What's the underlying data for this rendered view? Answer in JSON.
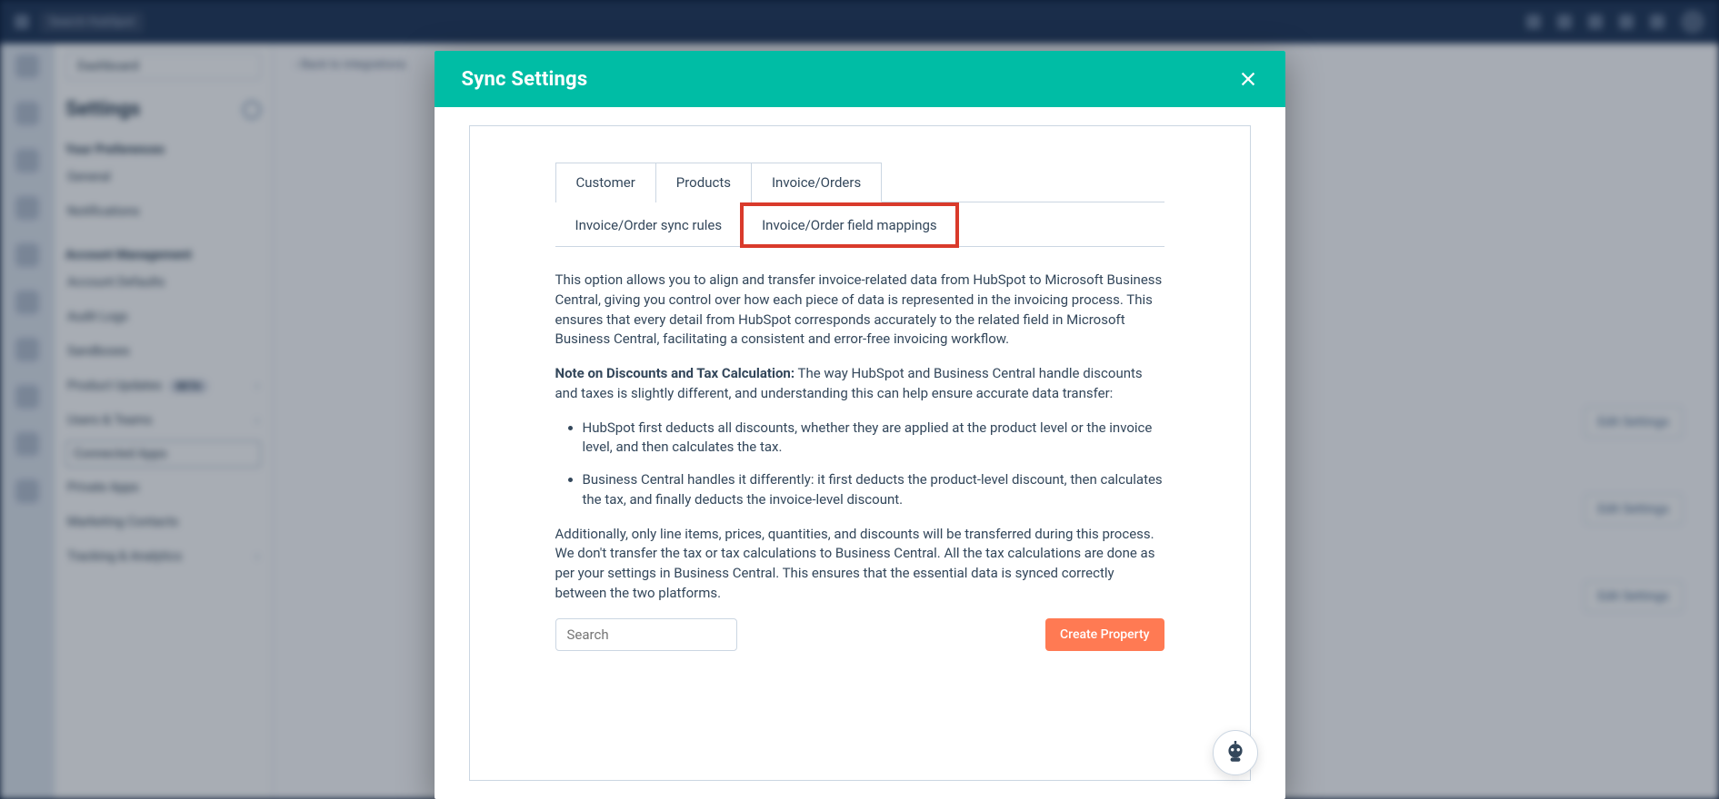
{
  "topbar": {
    "search_placeholder": "Search HubSpot"
  },
  "sidebar": {
    "back_chip": "Dashboard",
    "title": "Settings",
    "section_pref": "Your Preferences",
    "section_acct": "Account Management",
    "items_pref": [
      {
        "label": "General"
      },
      {
        "label": "Notifications"
      }
    ],
    "items_acct": [
      {
        "label": "Account Defaults"
      },
      {
        "label": "Audit Logs"
      },
      {
        "label": "Sandboxes"
      },
      {
        "label": "Product Updates",
        "beta": "BETA",
        "caret": "›"
      },
      {
        "label": "Users & Teams",
        "caret": "›"
      },
      {
        "label": "Connected Apps",
        "active": true
      },
      {
        "label": "Private Apps"
      },
      {
        "label": "Marketing Contacts"
      },
      {
        "label": "Tracking & Analytics",
        "caret": "›"
      }
    ]
  },
  "content": {
    "crumb_back": "‹  Back to integrations",
    "side_button": "Edit Settings"
  },
  "modal": {
    "title": "Sync Settings",
    "tabs_primary": [
      {
        "key": "customer",
        "label": "Customer"
      },
      {
        "key": "products",
        "label": "Products"
      },
      {
        "key": "invoice",
        "label": "Invoice/Orders",
        "selected": true
      }
    ],
    "tabs_secondary": [
      {
        "key": "rules",
        "label": "Invoice/Order sync rules"
      },
      {
        "key": "mappings",
        "label": "Invoice/Order field mappings",
        "highlight": true
      }
    ],
    "desc_p1": "This option allows you to align and transfer invoice-related data from HubSpot to Microsoft Business Central, giving you control over how each piece of data is represented in the invoicing process. This ensures that every detail from HubSpot corresponds accurately to the related field in Microsoft Business Central, facilitating a consistent and error-free invoicing workflow.",
    "desc_note_label": "Note on Discounts and Tax Calculation:",
    "desc_note_text": " The way HubSpot and Business Central handle discounts and taxes is slightly different, and understanding this can help ensure accurate data transfer:",
    "bullet1": "HubSpot first deducts all discounts, whether they are applied at the product level or the invoice level, and then calculates the tax.",
    "bullet2": "Business Central handles it differently: it first deducts the product-level discount, then calculates the tax, and finally deducts the invoice-level discount.",
    "desc_p3": "Additionally, only line items, prices, quantities, and discounts will be transferred during this process. We don't transfer the tax or tax calculations to Business Central. All the tax calculations are done as per your settings in Business Central. This ensures that the essential data is synced correctly between the two platforms.",
    "search_placeholder": "Search",
    "create_property": "Create Property"
  }
}
